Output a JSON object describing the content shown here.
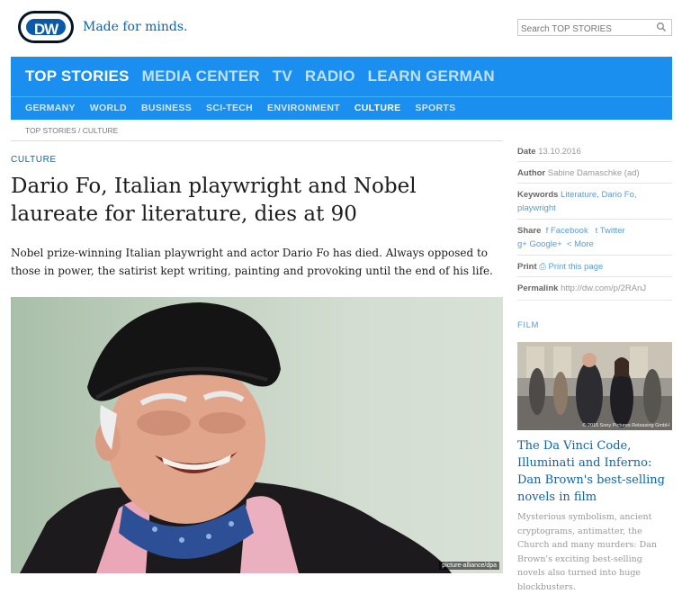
{
  "header": {
    "logo_text": "DW",
    "slogan": "Made for minds.",
    "search_placeholder": "Search TOP STORIES"
  },
  "nav": {
    "main": [
      {
        "label": "TOP STORIES",
        "active": true
      },
      {
        "label": "MEDIA CENTER",
        "active": false
      },
      {
        "label": "TV",
        "active": false
      },
      {
        "label": "RADIO",
        "active": false
      },
      {
        "label": "LEARN GERMAN",
        "active": false
      }
    ],
    "sub": [
      {
        "label": "GERMANY",
        "active": false
      },
      {
        "label": "WORLD",
        "active": false
      },
      {
        "label": "BUSINESS",
        "active": false
      },
      {
        "label": "SCI-TECH",
        "active": false
      },
      {
        "label": "ENVIRONMENT",
        "active": false
      },
      {
        "label": "CULTURE",
        "active": true
      },
      {
        "label": "SPORTS",
        "active": false
      }
    ]
  },
  "breadcrumb": "TOP STORIES / CULTURE",
  "article": {
    "kicker": "CULTURE",
    "headline": "Dario Fo, Italian playwright and Nobel laureate for literature, dies at 90",
    "teaser": "Nobel prize-winning Italian playwright and actor Dario Fo has died. Always opposed to those in power, the satirist kept writing, painting and provoking until the end of his life.",
    "photo_credit": "picture-alliance/dpa"
  },
  "sidebar": {
    "date_label": "Date",
    "date_value": "13.10.2016",
    "author_label": "Author",
    "author_value": "Sabine Damaschke (ad)",
    "keywords_label": "Keywords",
    "keywords_value": "Literature, Dario Fo, playwright",
    "share_label": "Share",
    "share_facebook": "Facebook",
    "share_twitter": "Twitter",
    "share_google": "Google+",
    "share_more": "More",
    "print_label": "Print",
    "print_link": "Print this page",
    "permalink_label": "Permalink",
    "permalink_value": "http://dw.com/p/2RAnJ",
    "film_label": "FILM",
    "film_image_copy": "© 2016 Sony Pictures Releasing GmbH",
    "film_title": "The Da Vinci Code, Illuminati and Inferno: Dan Brown's best-selling novels in film",
    "film_desc": "Mysterious symbolism, ancient cryptograms, antimatter, the Church and many murders: Dan Brown's exciting best-selling novels also turned into huge blockbusters."
  },
  "colors": {
    "brand_blue": "#1a8ff0",
    "link_blue": "#0a64b4"
  }
}
